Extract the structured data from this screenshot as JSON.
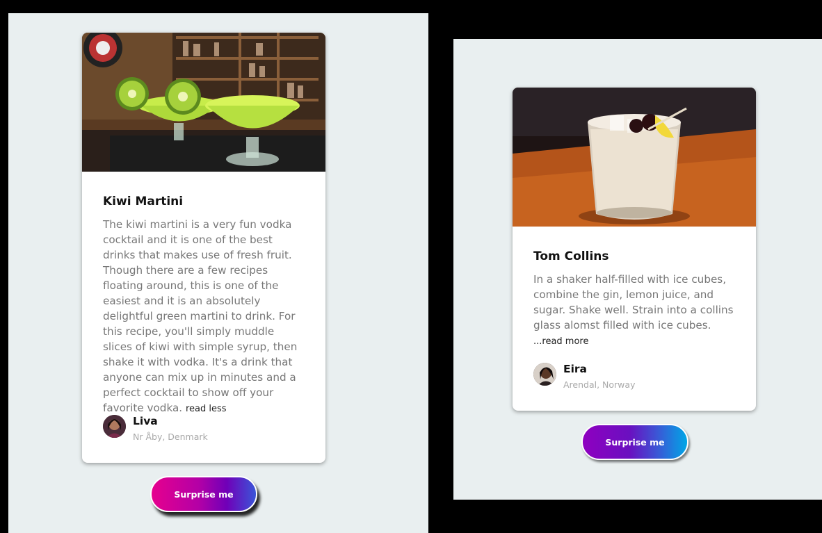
{
  "cards": [
    {
      "image": "kiwi-martini-photo",
      "title": "Kiwi Martini",
      "description": "The kiwi martini is a very fun vodka cocktail and it is one of the best drinks that makes use of fresh fruit. Though there are a few recipes floating around, this is one of the easiest and it is an absolutely delightful green martini to drink. For this recipe, you'll simply muddle slices of kiwi with simple syrup, then shake it with vodka. It's a drink that anyone can mix up in minutes and a perfect cocktail to show off your favorite vodka.",
      "toggle_label": "read less",
      "author": {
        "name": "Liva",
        "location": "Nr Åby, Denmark"
      },
      "button_label": "Surprise me"
    },
    {
      "image": "tom-collins-photo",
      "title": "Tom Collins",
      "description": "In a shaker half-filled with ice cubes, combine the gin, lemon juice, and sugar. Shake well. Strain into a collins glass alomst filled with ice cubes.",
      "toggle_label": "...read more",
      "author": {
        "name": "Eira",
        "location": "Arendal, Norway"
      },
      "button_label": "Surprise me"
    }
  ],
  "colors": {
    "panel_bg": "#e9eff0",
    "outer_bg": "#000000",
    "button_left_gradient": [
      "#e6008e",
      "#7000b8",
      "#3a55d8"
    ],
    "button_right_gradient": [
      "#8f00c0",
      "#3a58d6",
      "#00a6e6"
    ]
  }
}
